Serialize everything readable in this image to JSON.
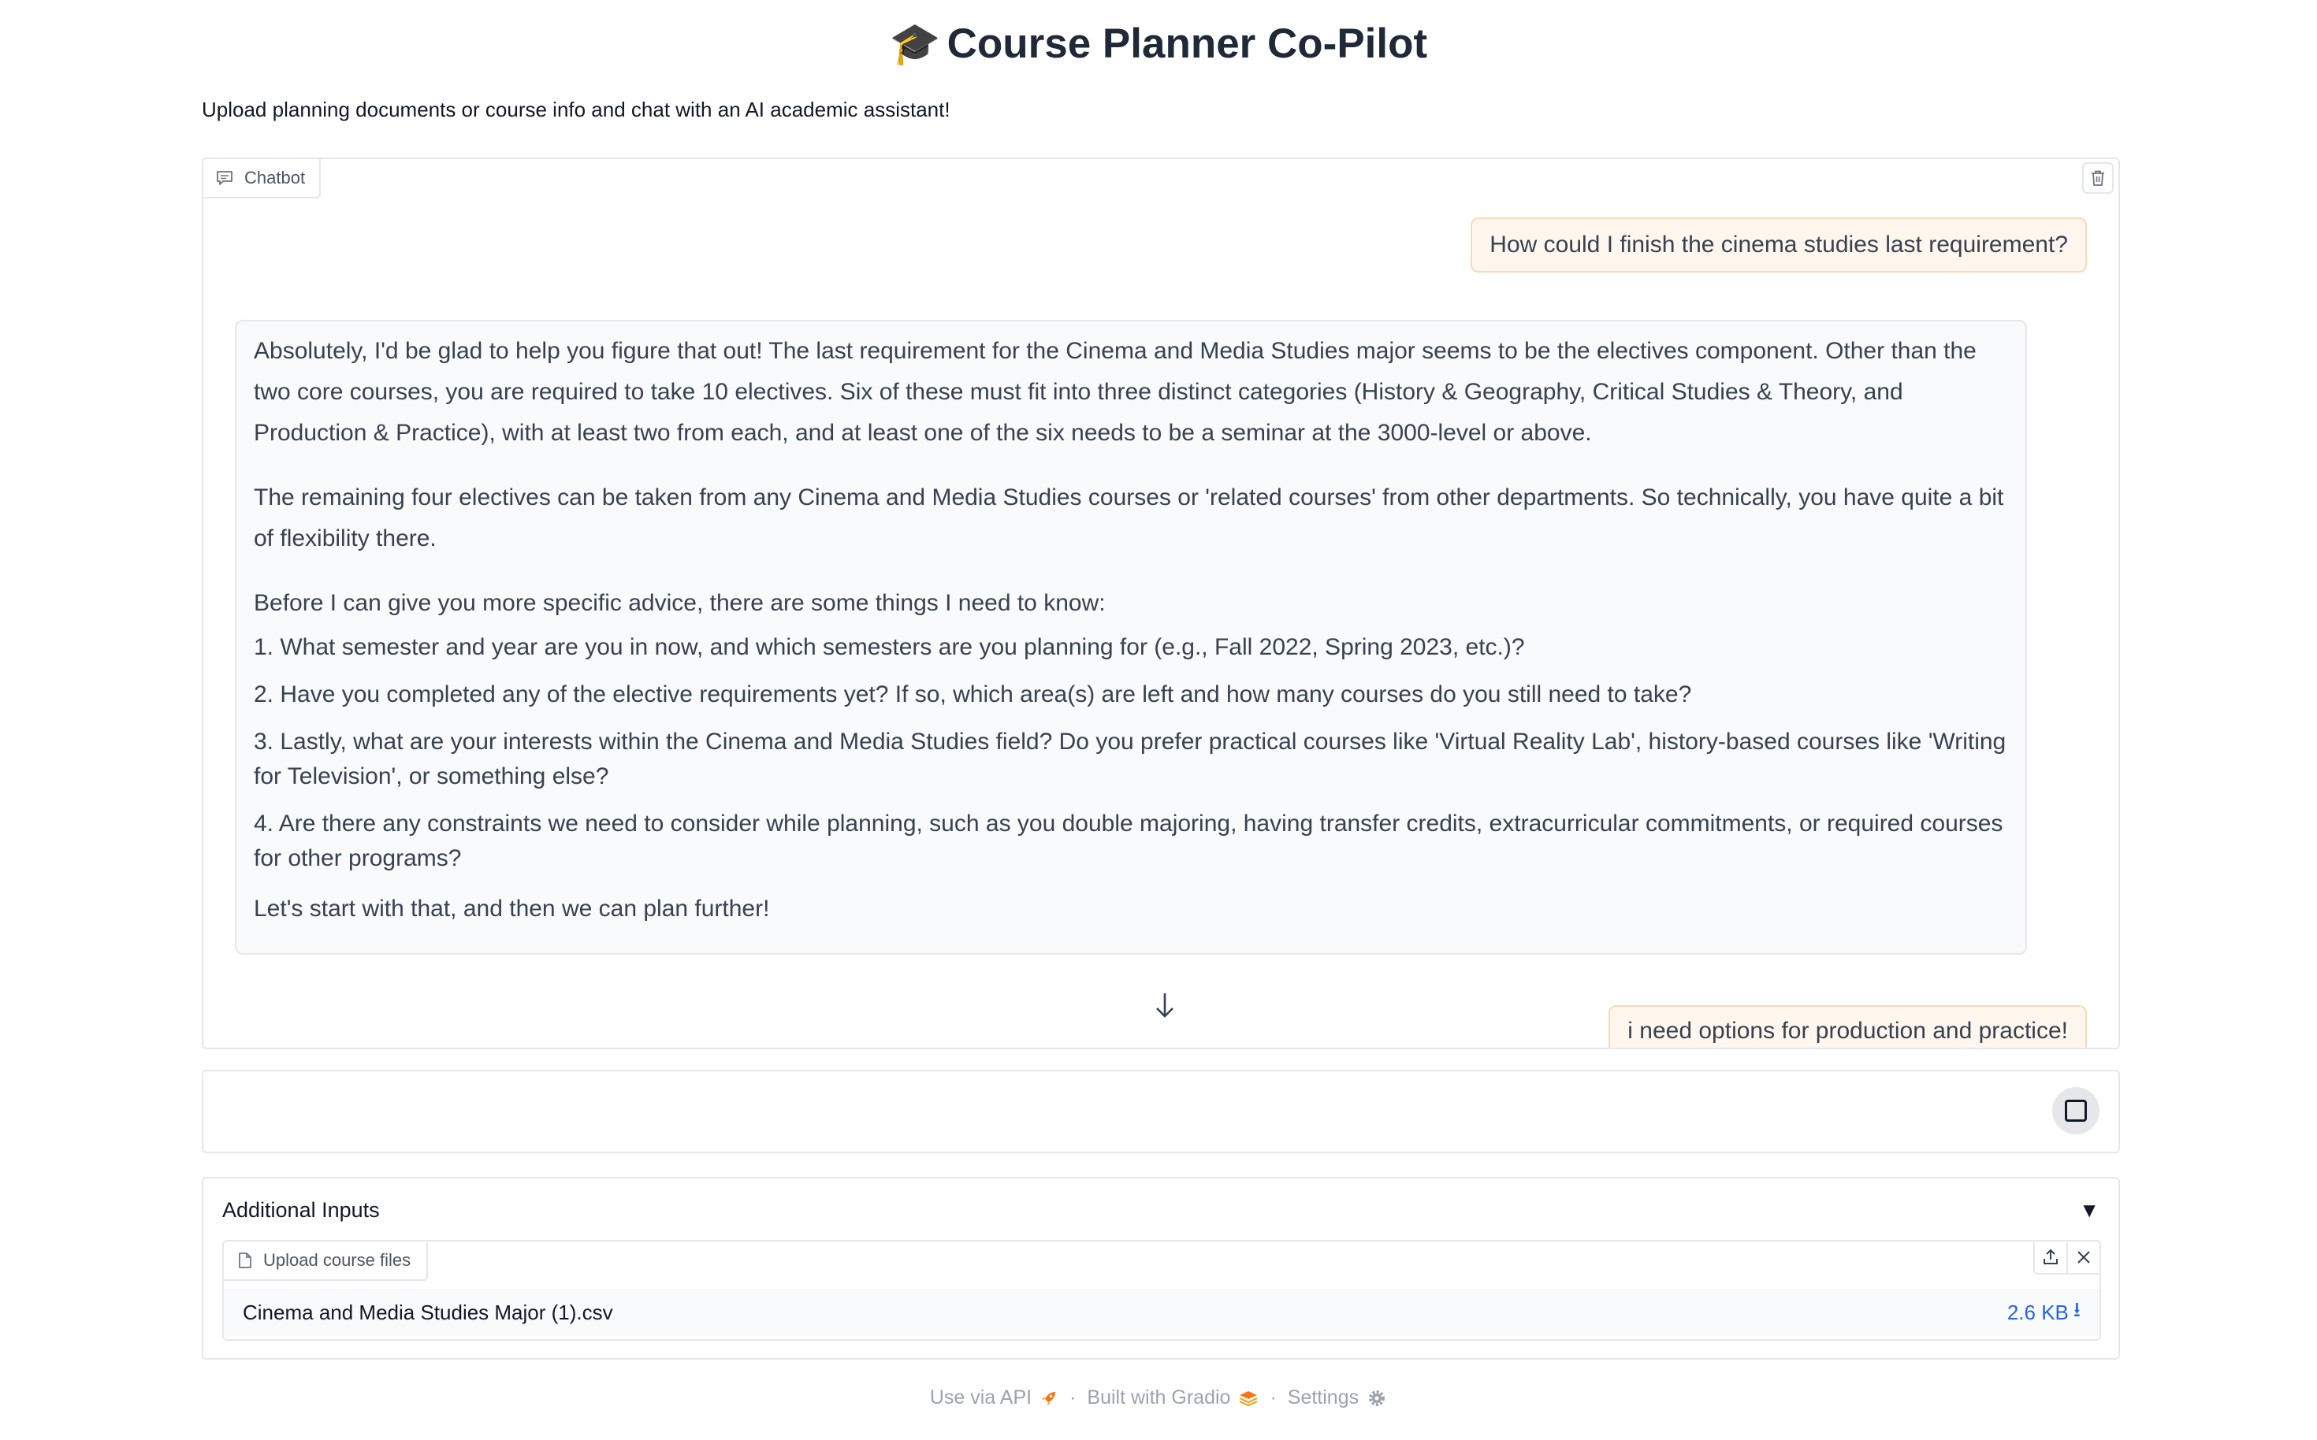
{
  "header": {
    "emoji": "🎓",
    "title": "Course Planner Co-Pilot",
    "description": "Upload planning documents or course info and chat with an AI academic assistant!"
  },
  "chatbot": {
    "label": "Chatbot",
    "messages": {
      "user_1": "How could I finish the cinema studies last requirement?",
      "bot_1": {
        "p1": "Absolutely, I'd be glad to help you figure that out! The last requirement for the Cinema and Media Studies major seems to be the electives component. Other than the two core courses, you are required to take 10 electives. Six of these must fit into three distinct categories (History & Geography, Critical Studies & Theory, and Production & Practice), with at least two from each, and at least one of the six needs to be a seminar at the 3000-level or above.",
        "p2": "The remaining four electives can be taken from any Cinema and Media Studies courses or 'related courses' from other departments. So technically, you have quite a bit of flexibility there.",
        "p3": "Before I can give you more specific advice, there are some things I need to know:",
        "items": [
          "1. What semester and year are you in now, and which semesters are you planning for (e.g., Fall 2022, Spring 2023, etc.)?",
          "2. Have you completed any of the elective requirements yet? If so, which area(s) are left and how many courses do you still need to take?",
          "3. Lastly, what are your interests within the Cinema and Media Studies field? Do you prefer practical courses like 'Virtual Reality Lab', history-based courses like 'Writing for Television', or something else?",
          "4. Are there any constraints we need to consider while planning, such as you double majoring, having transfer credits, extracurricular commitments, or required courses for other programs?"
        ],
        "closing": "Let's start with that, and then we can plan further!"
      },
      "user_2": "i need options for production and practice!"
    }
  },
  "input": {
    "value": "",
    "placeholder": ""
  },
  "additional_inputs": {
    "title": "Additional Inputs",
    "toggle": "▼",
    "upload_label": "Upload course files",
    "file": {
      "name": "Cinema and Media Studies Major (1).csv",
      "size": "2.6 KB",
      "download_glyph": "⭳"
    }
  },
  "footer": {
    "api": "Use via API",
    "built": "Built with Gradio",
    "settings": "Settings",
    "separator": "·"
  },
  "colors": {
    "user_bubble_bg": "#fff7ed",
    "user_bubble_border": "#fcd9b4",
    "bot_bubble_bg": "#f9fafb",
    "link_blue": "#2563eb"
  }
}
